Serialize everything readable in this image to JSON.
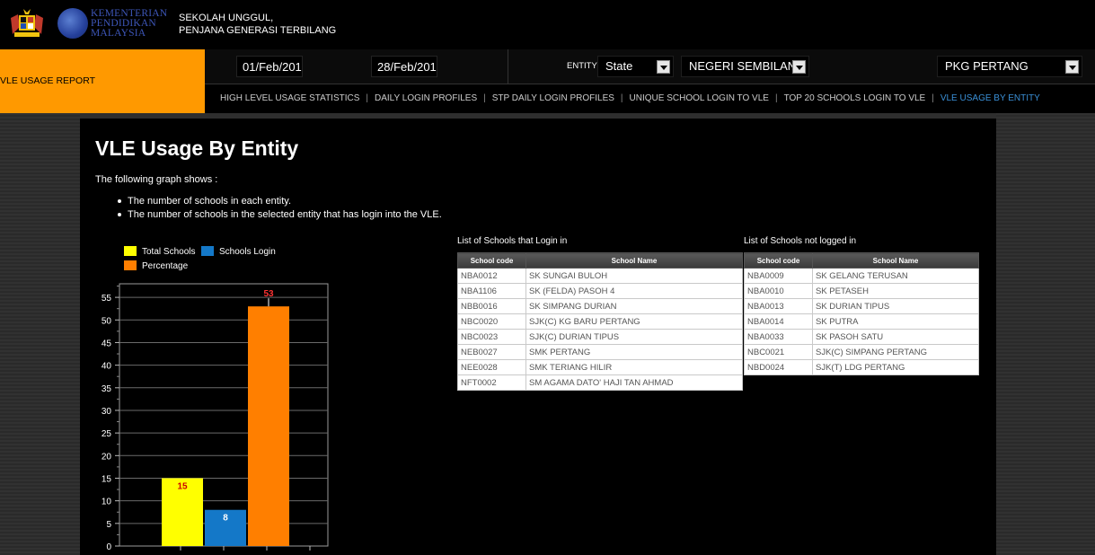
{
  "header": {
    "ministry_line1": "KEMENTERIAN",
    "ministry_line2": "PENDIDIKAN",
    "ministry_line3": "MALAYSIA",
    "tagline_line1": "SEKOLAH UNGGUL,",
    "tagline_line2": "PENJANA GENERASI TERBILANG"
  },
  "report": {
    "title": "VLE USAGE REPORT"
  },
  "filters": {
    "date_from": "01/Feb/201",
    "date_to": "28/Feb/201",
    "entity_label": "ENTITY",
    "entity_value": "State",
    "state_value": "NEGERI SEMBILAN",
    "pkg_value": "PKG PERTANG"
  },
  "nav": {
    "items": [
      {
        "label": "HIGH LEVEL USAGE STATISTICS"
      },
      {
        "label": "DAILY LOGIN PROFILES"
      },
      {
        "label": "STP DAILY LOGIN PROFILES"
      },
      {
        "label": "UNIQUE SCHOOL LOGIN TO VLE"
      },
      {
        "label": "TOP 20 SCHOOLS LOGIN TO VLE"
      },
      {
        "label": "VLE USAGE BY ENTITY"
      }
    ],
    "separator": "|"
  },
  "content": {
    "title": "VLE Usage By Entity",
    "intro": "The following graph shows :",
    "bullets": [
      "The number of schools in each entity.",
      "The number of schools in the selected entity that has login into the VLE."
    ]
  },
  "legend": {
    "total": "Total Schools",
    "login": "Schools Login",
    "percentage": "Percentage"
  },
  "colors": {
    "accent_orange": "#ff9900",
    "total_bar": "#ffff00",
    "login_bar": "#1478c8",
    "percentage_bar": "#ff7f00",
    "nav_active": "#3a8fd6"
  },
  "chart_data": {
    "type": "bar",
    "categories": [
      "Total Schools",
      "Schools Login",
      "Percentage"
    ],
    "values": [
      15,
      8,
      53
    ],
    "data_labels": [
      "15",
      "8",
      "53"
    ],
    "ylim": [
      0,
      55
    ],
    "y_ticks": [
      "0",
      "5",
      "10",
      "15",
      "20",
      "25",
      "30",
      "35",
      "40",
      "45",
      "50",
      "55"
    ],
    "grid": true,
    "legend": "top-left"
  },
  "tables": {
    "login": {
      "caption": "List of Schools that Login in",
      "headers": [
        "School code",
        "School Name"
      ],
      "rows": [
        [
          "NBA0012",
          "SK SUNGAI BULOH"
        ],
        [
          "NBA1106",
          "SK (FELDA) PASOH 4"
        ],
        [
          "NBB0016",
          "SK SIMPANG DURIAN"
        ],
        [
          "NBC0020",
          "SJK(C) KG BARU PERTANG"
        ],
        [
          "NBC0023",
          "SJK(C) DURIAN TIPUS"
        ],
        [
          "NEB0027",
          "SMK PERTANG"
        ],
        [
          "NEE0028",
          "SMK TERIANG HILIR"
        ],
        [
          "NFT0002",
          "SM AGAMA DATO' HAJI TAN AHMAD"
        ]
      ]
    },
    "not_logged": {
      "caption": "List of Schools not logged in",
      "headers": [
        "School code",
        "School Name"
      ],
      "rows": [
        [
          "NBA0009",
          "SK GELANG TERUSAN"
        ],
        [
          "NBA0010",
          "SK PETASEH"
        ],
        [
          "NBA0013",
          "SK DURIAN TIPUS"
        ],
        [
          "NBA0014",
          "SK PUTRA"
        ],
        [
          "NBA0033",
          "SK PASOH SATU"
        ],
        [
          "NBC0021",
          "SJK(C) SIMPANG PERTANG"
        ],
        [
          "NBD0024",
          "SJK(T) LDG PERTANG"
        ]
      ]
    }
  }
}
